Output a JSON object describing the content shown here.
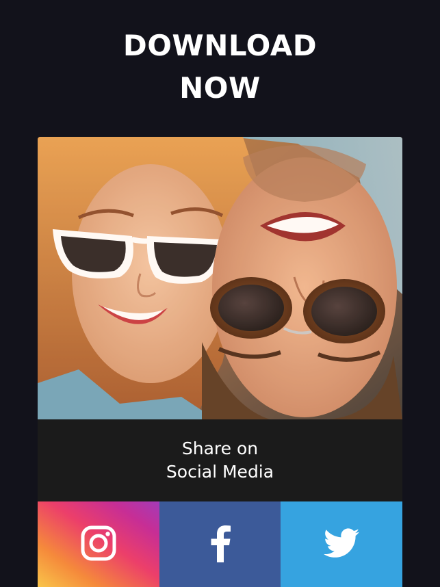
{
  "headline": {
    "line1": "DOWNLOAD",
    "line2": "NOW"
  },
  "photo": {
    "description_icon": "couple-selfie-photo"
  },
  "share": {
    "line1": "Share on",
    "line2": "Social Media"
  },
  "social": {
    "instagram_icon": "instagram-icon",
    "facebook_icon": "facebook-icon",
    "twitter_icon": "twitter-icon",
    "colors": {
      "facebook": "#3c5a99",
      "twitter": "#36a3e0",
      "background": "#12121b"
    }
  }
}
